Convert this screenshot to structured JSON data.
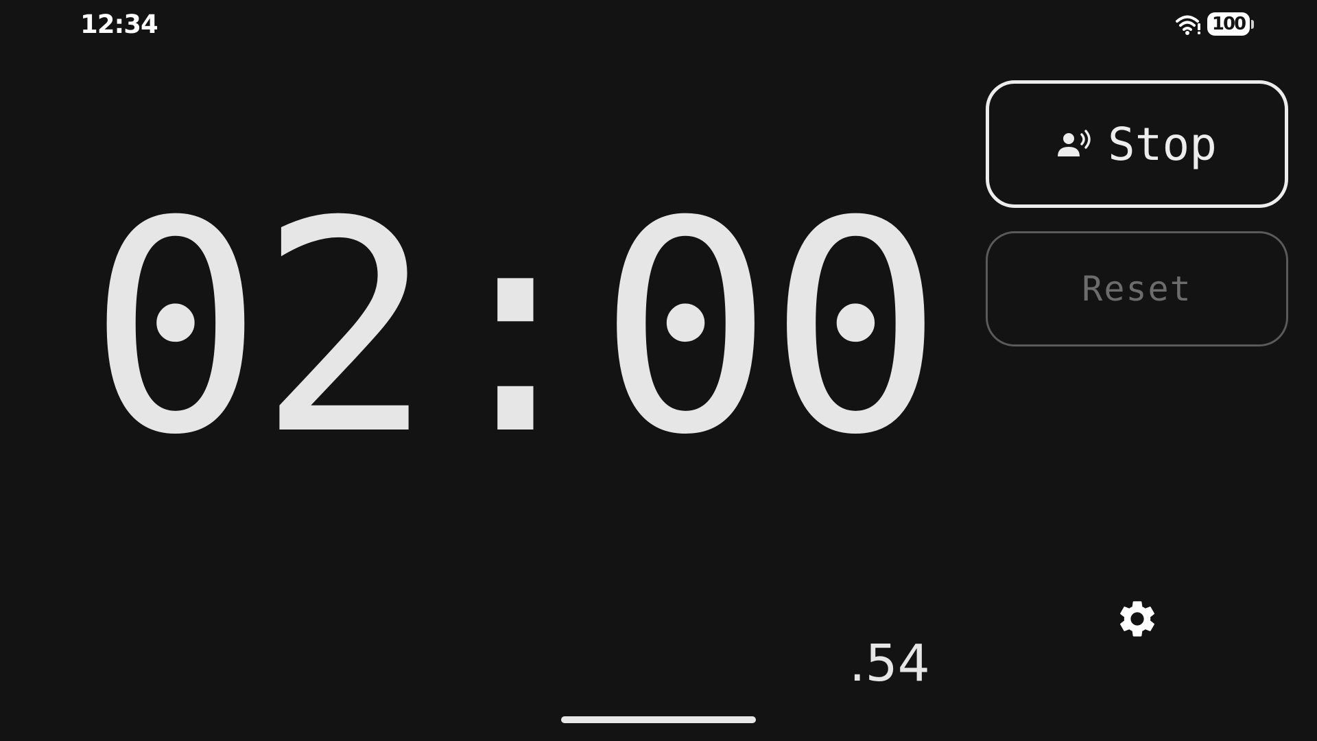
{
  "status_bar": {
    "time": "12:34",
    "battery_level": "100",
    "wifi_icon": "wifi-icon"
  },
  "timer": {
    "display": "02:00",
    "fraction": ".54"
  },
  "controls": {
    "stop_label": "Stop",
    "stop_icon": "voice-command-icon",
    "reset_label": "Reset",
    "settings_icon": "gear-icon"
  },
  "colors": {
    "background": "#131313",
    "text": "#e6e6e6",
    "disabled": "#6c6c6c"
  }
}
